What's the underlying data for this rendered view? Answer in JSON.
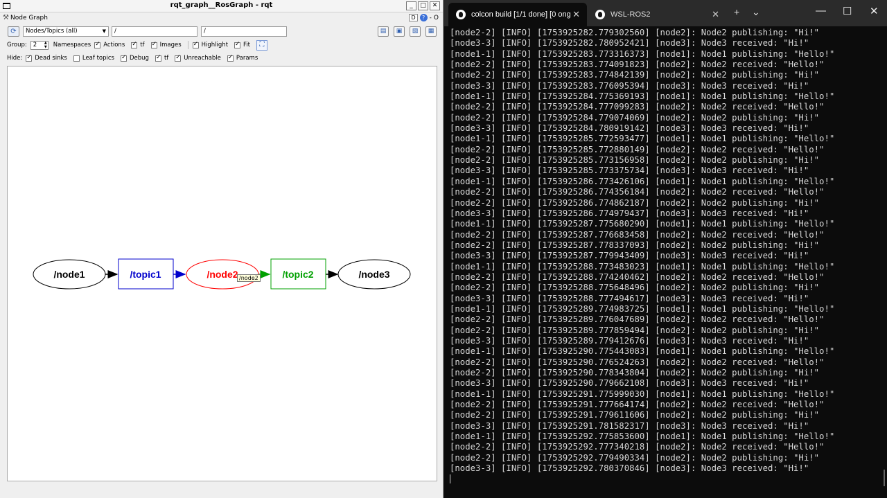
{
  "rqt": {
    "window_title": "rqt_graph__RosGraph - rqt",
    "window_buttons": [
      "_",
      "□",
      "✕"
    ],
    "plugin_title": "Node Graph",
    "plugin_right": [
      "D",
      "?",
      "-",
      "O"
    ],
    "toolbar": {
      "mode_select": "Nodes/Topics (all)",
      "filter1": "/",
      "filter2": "/"
    },
    "options_row": {
      "group_label": "Group:",
      "group_value": "2",
      "namespaces": "Namespaces",
      "actions": "Actions",
      "tf": "tf",
      "images": "Images",
      "highlight": "Highlight",
      "fit": "Fit"
    },
    "hide_row": {
      "hide_label": "Hide:",
      "dead_sinks": "Dead sinks",
      "leaf_topics": "Leaf topics",
      "debug": "Debug",
      "tf": "tf",
      "unreachable": "Unreachable",
      "params": "Params"
    },
    "graph": {
      "node1": "/node1",
      "topic1": "/topic1",
      "node2": "/node2",
      "topic2": "/topic2",
      "node3": "/node3",
      "tooltip": "/node2",
      "colors": {
        "topic1": "#0000cc",
        "node2": "#ff0000",
        "topic2": "#00a000",
        "default": "#000000"
      }
    }
  },
  "terminal": {
    "tab_active": "colcon build [1/1 done] [0 ong",
    "tab_inactive": "WSL-ROS2",
    "controls": [
      "+",
      "⌄"
    ],
    "window_controls": [
      "—",
      "☐",
      "✕"
    ],
    "lines": [
      "[node2-2] [INFO] [1753925282.779302560] [node2]: Node2 publishing: \"Hi!\"",
      "[node3-3] [INFO] [1753925282.780952421] [node3]: Node3 received: \"Hi!\"",
      "[node1-1] [INFO] [1753925283.773316373] [node1]: Node1 publishing: \"Hello!\"",
      "[node2-2] [INFO] [1753925283.774091823] [node2]: Node2 received: \"Hello!\"",
      "[node2-2] [INFO] [1753925283.774842139] [node2]: Node2 publishing: \"Hi!\"",
      "[node3-3] [INFO] [1753925283.776095394] [node3]: Node3 received: \"Hi!\"",
      "[node1-1] [INFO] [1753925284.775369193] [node1]: Node1 publishing: \"Hello!\"",
      "[node2-2] [INFO] [1753925284.777099283] [node2]: Node2 received: \"Hello!\"",
      "[node2-2] [INFO] [1753925284.779074069] [node2]: Node2 publishing: \"Hi!\"",
      "[node3-3] [INFO] [1753925284.780919142] [node3]: Node3 received: \"Hi!\"",
      "[node1-1] [INFO] [1753925285.772593477] [node1]: Node1 publishing: \"Hello!\"",
      "[node2-2] [INFO] [1753925285.772880149] [node2]: Node2 received: \"Hello!\"",
      "[node2-2] [INFO] [1753925285.773156958] [node2]: Node2 publishing: \"Hi!\"",
      "[node3-3] [INFO] [1753925285.773375734] [node3]: Node3 received: \"Hi!\"",
      "[node1-1] [INFO] [1753925286.773426106] [node1]: Node1 publishing: \"Hello!\"",
      "[node2-2] [INFO] [1753925286.774356184] [node2]: Node2 received: \"Hello!\"",
      "[node2-2] [INFO] [1753925286.774862187] [node2]: Node2 publishing: \"Hi!\"",
      "[node3-3] [INFO] [1753925286.774979437] [node3]: Node3 received: \"Hi!\"",
      "[node1-1] [INFO] [1753925287.775680290] [node1]: Node1 publishing: \"Hello!\"",
      "[node2-2] [INFO] [1753925287.776683458] [node2]: Node2 received: \"Hello!\"",
      "[node2-2] [INFO] [1753925287.778337093] [node2]: Node2 publishing: \"Hi!\"",
      "[node3-3] [INFO] [1753925287.779943409] [node3]: Node3 received: \"Hi!\"",
      "[node1-1] [INFO] [1753925288.773483023] [node1]: Node1 publishing: \"Hello!\"",
      "[node2-2] [INFO] [1753925288.774240462] [node2]: Node2 received: \"Hello!\"",
      "[node2-2] [INFO] [1753925288.775648496] [node2]: Node2 publishing: \"Hi!\"",
      "[node3-3] [INFO] [1753925288.777494617] [node3]: Node3 received: \"Hi!\"",
      "[node1-1] [INFO] [1753925289.774983725] [node1]: Node1 publishing: \"Hello!\"",
      "[node2-2] [INFO] [1753925289.776047689] [node2]: Node2 received: \"Hello!\"",
      "[node2-2] [INFO] [1753925289.777859494] [node2]: Node2 publishing: \"Hi!\"",
      "[node3-3] [INFO] [1753925289.779412676] [node3]: Node3 received: \"Hi!\"",
      "[node1-1] [INFO] [1753925290.775443083] [node1]: Node1 publishing: \"Hello!\"",
      "[node2-2] [INFO] [1753925290.776524263] [node2]: Node2 received: \"Hello!\"",
      "[node2-2] [INFO] [1753925290.778343804] [node2]: Node2 publishing: \"Hi!\"",
      "[node3-3] [INFO] [1753925290.779662108] [node3]: Node3 received: \"Hi!\"",
      "[node1-1] [INFO] [1753925291.775999030] [node1]: Node1 publishing: \"Hello!\"",
      "[node2-2] [INFO] [1753925291.777664174] [node2]: Node2 received: \"Hello!\"",
      "[node2-2] [INFO] [1753925291.779611606] [node2]: Node2 publishing: \"Hi!\"",
      "[node3-3] [INFO] [1753925291.781582317] [node3]: Node3 received: \"Hi!\"",
      "[node1-1] [INFO] [1753925292.775853600] [node1]: Node1 publishing: \"Hello!\"",
      "[node2-2] [INFO] [1753925292.777340218] [node2]: Node2 received: \"Hello!\"",
      "[node2-2] [INFO] [1753925292.779490334] [node2]: Node2 publishing: \"Hi!\"",
      "[node3-3] [INFO] [1753925292.780370846] [node3]: Node3 received: \"Hi!\""
    ]
  }
}
